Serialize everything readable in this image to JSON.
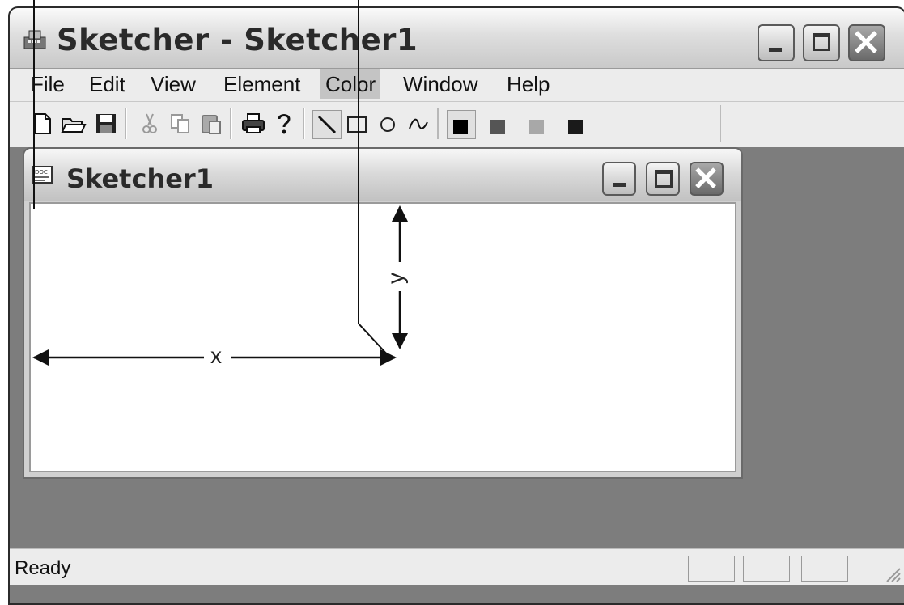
{
  "window": {
    "title": "Sketcher - Sketcher1",
    "icon": "app-icon",
    "controls": [
      "minimize-icon",
      "maximize-icon",
      "close-icon"
    ]
  },
  "menu": [
    {
      "label": "File"
    },
    {
      "label": "Edit"
    },
    {
      "label": "View"
    },
    {
      "label": "Element"
    },
    {
      "label": "Color",
      "active": true
    },
    {
      "label": "Window"
    },
    {
      "label": "Help"
    }
  ],
  "toolbar": {
    "file": [
      "new-file-icon",
      "open-folder-icon",
      "save-icon"
    ],
    "edit": [
      "cut-icon",
      "copy-icon",
      "paste-icon"
    ],
    "misc": [
      "print-icon",
      "help-icon"
    ],
    "elements": [
      "line-icon",
      "rectangle-icon",
      "circle-icon",
      "curve-icon"
    ],
    "colors": [
      {
        "name": "black",
        "hex": "#000000",
        "selected": true
      },
      {
        "name": "red",
        "hex": "#555555"
      },
      {
        "name": "green",
        "hex": "#a8a8a8"
      },
      {
        "name": "blue",
        "hex": "#1a1a1a"
      }
    ]
  },
  "child_window": {
    "title": "Sketcher1",
    "icon": "document-icon",
    "controls": [
      "minimize-icon",
      "maximize-icon",
      "close-icon"
    ]
  },
  "canvas": {
    "x_label": "x",
    "y_label": "y"
  },
  "status": {
    "text": "Ready"
  },
  "colors": {
    "workspace": "#7d7d7d",
    "chrome": "#ececec"
  }
}
